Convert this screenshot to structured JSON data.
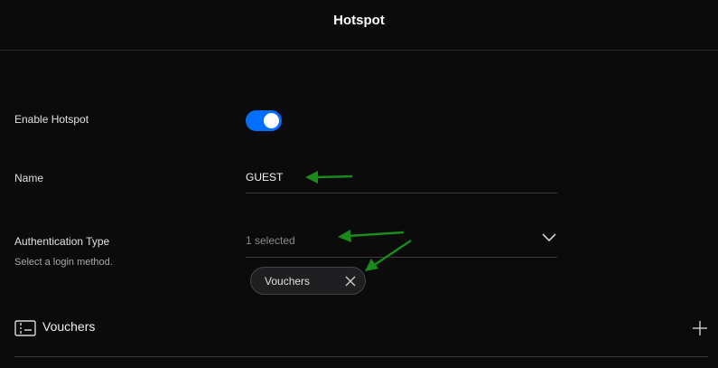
{
  "header": {
    "title": "Hotspot"
  },
  "settings": {
    "enable_hotspot": {
      "label": "Enable Hotspot",
      "enabled": true
    },
    "name": {
      "label": "Name",
      "value": "GUEST"
    },
    "authentication_type": {
      "label": "Authentication Type",
      "hint": "Select a login method.",
      "selected_text": "1 selected",
      "selected_chips": [
        "Vouchers"
      ]
    }
  },
  "vouchers_section": {
    "title": "Vouchers"
  },
  "icons": {
    "chevron": "chevron-down-icon",
    "chip_close": "close-icon",
    "section": "voucher-icon",
    "add": "plus-icon"
  },
  "colors": {
    "accent": "#006fff",
    "annotation_arrows": "#1a8a1a",
    "background": "#0b0b0c"
  }
}
